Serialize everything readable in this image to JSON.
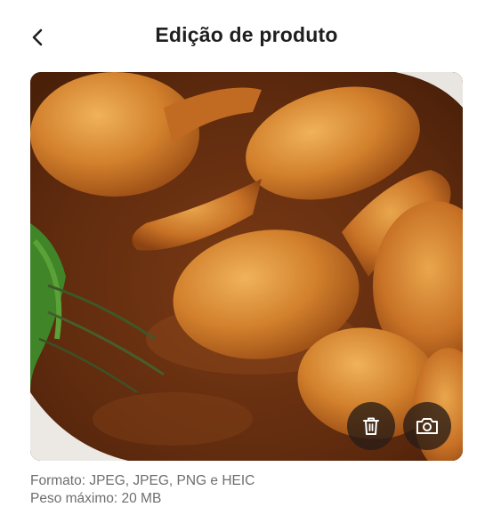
{
  "header": {
    "back_icon": "chevron-left-icon",
    "title": "Edição de produto"
  },
  "photo": {
    "subject": "chicken-drumsticks-in-sauce",
    "actions": {
      "delete_icon": "trash-icon",
      "camera_icon": "camera-icon"
    }
  },
  "info": {
    "format": "Formato: JPEG, JPEG, PNG e HEIC",
    "size": "Peso máximo: 20 MB"
  },
  "colors": {
    "title": "#1f1f1f",
    "info_text": "#6e6e6e",
    "overlay_button": "#281c16"
  }
}
